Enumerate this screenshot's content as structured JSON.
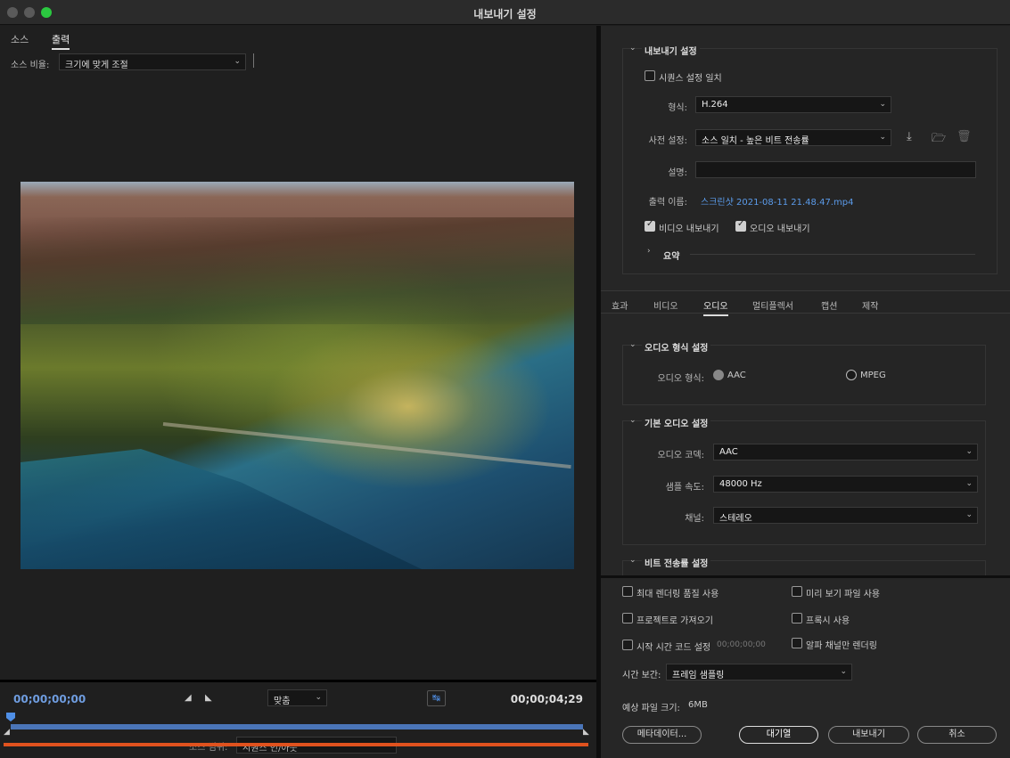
{
  "window": {
    "title": "내보내기 설정"
  },
  "left_panel": {
    "tabs": [
      {
        "label": "소스"
      },
      {
        "label": "출력"
      }
    ],
    "source_ratio_label": "소스 비율:",
    "source_ratio_value": "크기에 맞게 조절",
    "timecode_start": "00;00;00;00",
    "timecode_end": "00;00;04;29",
    "fit_value": "맞춤",
    "source_range_label": "소스 범위:",
    "source_range_value": "시퀀스 인/아웃"
  },
  "export_settings": {
    "title": "내보내기 설정",
    "match_sequence": {
      "label": "시퀀스 설정 일치",
      "checked": false
    },
    "format_label": "형식:",
    "format_value": "H.264",
    "preset_label": "사전 설정:",
    "preset_value": "소스 일치 - 높은 비트 전송률",
    "comments_label": "설명:",
    "comments_value": "",
    "output_name_label": "출력 이름:",
    "output_name_value": "스크린샷 2021-08-11 21.48.47.mp4",
    "export_video": {
      "label": "비디오 내보내기",
      "checked": true
    },
    "export_audio": {
      "label": "오디오 내보내기",
      "checked": true
    },
    "summary_label": "요약"
  },
  "settings_tabs": [
    {
      "label": "효과"
    },
    {
      "label": "비디오"
    },
    {
      "label": "오디오",
      "active": true
    },
    {
      "label": "멀티플렉서"
    },
    {
      "label": "캡션"
    },
    {
      "label": "제작"
    }
  ],
  "audio_format": {
    "title": "오디오 형식 설정",
    "label": "오디오 형식:",
    "options": [
      {
        "label": "AAC",
        "selected": true
      },
      {
        "label": "MPEG",
        "selected": false
      }
    ]
  },
  "basic_audio": {
    "title": "기본 오디오 설정",
    "codec_label": "오디오 코덱:",
    "codec_value": "AAC",
    "sample_rate_label": "샘플 속도:",
    "sample_rate_value": "48000 Hz",
    "channels_label": "채널:",
    "channels_value": "스테레오"
  },
  "bitrate": {
    "title": "비트 전송률 설정"
  },
  "bottom": {
    "max_render_quality": {
      "label": "최대 렌더링 품질 사용",
      "checked": false
    },
    "use_previews": {
      "label": "미리 보기 파일 사용",
      "checked": false
    },
    "import_into_project": {
      "label": "프로젝트로 가져오기",
      "checked": false
    },
    "use_proxies": {
      "label": "프록시 사용",
      "checked": false
    },
    "set_start_timecode": {
      "label": "시작 시간 코드 설정",
      "checked": false
    },
    "start_timecode_value": "00;00;00;00",
    "render_alpha_only": {
      "label": "알파 채널만 렌더링",
      "checked": false
    },
    "time_interpolation_label": "시간 보간:",
    "time_interpolation_value": "프레임 샘플링",
    "estimated_size_label": "예상 파일 크기:",
    "estimated_size_value": "6MB",
    "buttons": {
      "metadata": "메타데이터...",
      "queue": "대기열",
      "export": "내보내기",
      "cancel": "취소"
    }
  }
}
